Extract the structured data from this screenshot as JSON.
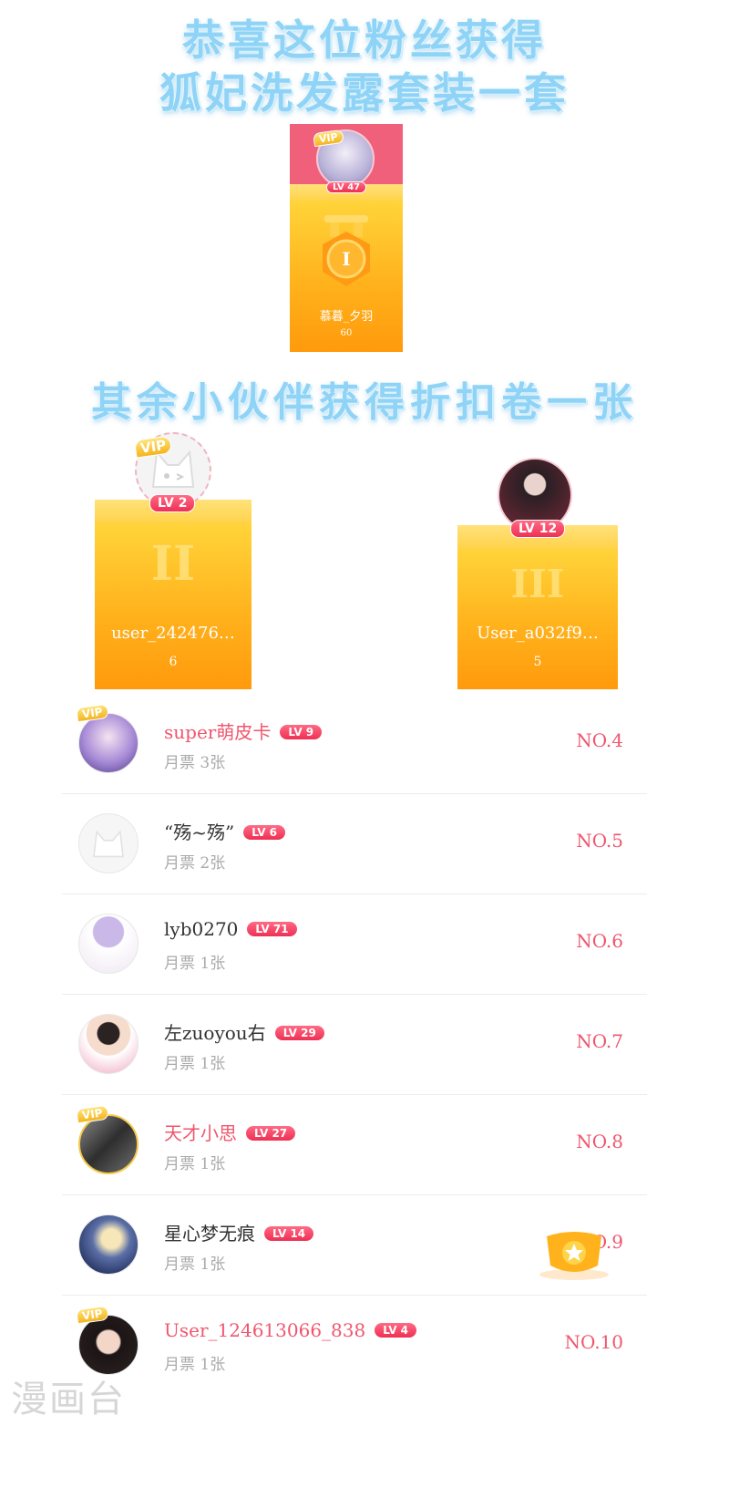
{
  "banners": {
    "line1": "恭喜这位粉丝获得",
    "line2": "狐妃洗发露套装一套",
    "line3": "其余小伙伴获得折扣卷一张"
  },
  "podium": {
    "first": {
      "rank_symbol": "I",
      "name": "慕暮_夕羽",
      "score": "60",
      "level": "LV 47",
      "vip": "VIP"
    },
    "second": {
      "rank_symbol": "II",
      "name": "user_242476…",
      "score": "6",
      "level": "LV 2",
      "vip": "VIP"
    },
    "third": {
      "rank_symbol": "III",
      "name": "User_a032f9…",
      "score": "5",
      "level": "LV 12"
    }
  },
  "list": [
    {
      "name": "super萌皮卡",
      "level": "LV 9",
      "votes": "月票 3张",
      "rank": "NO.4",
      "vip": "VIP"
    },
    {
      "name": "“殇~殇”",
      "level": "LV 6",
      "votes": "月票 2张",
      "rank": "NO.5"
    },
    {
      "name": "lyb0270",
      "level": "LV 71",
      "votes": "月票 1张",
      "rank": "NO.6"
    },
    {
      "name": "左zuoyou右",
      "level": "LV 29",
      "votes": "月票 1张",
      "rank": "NO.7"
    },
    {
      "name": "天才小思",
      "level": "LV 27",
      "votes": "月票 1张",
      "rank": "NO.8",
      "vip": "VIP"
    },
    {
      "name": "星心梦无痕",
      "level": "LV 14",
      "votes": "月票 1张",
      "rank": "NO.9"
    },
    {
      "name": "User_124613066_838",
      "level": "LV 4",
      "votes": "月票 1张",
      "rank": "NO.10",
      "vip": "VIP"
    }
  ],
  "watermark": "漫画台",
  "colors": {
    "accent": "#f0566e",
    "banner": "#8fd3f6",
    "podium": "#ffb21c",
    "first_bg": "#f0607a"
  }
}
